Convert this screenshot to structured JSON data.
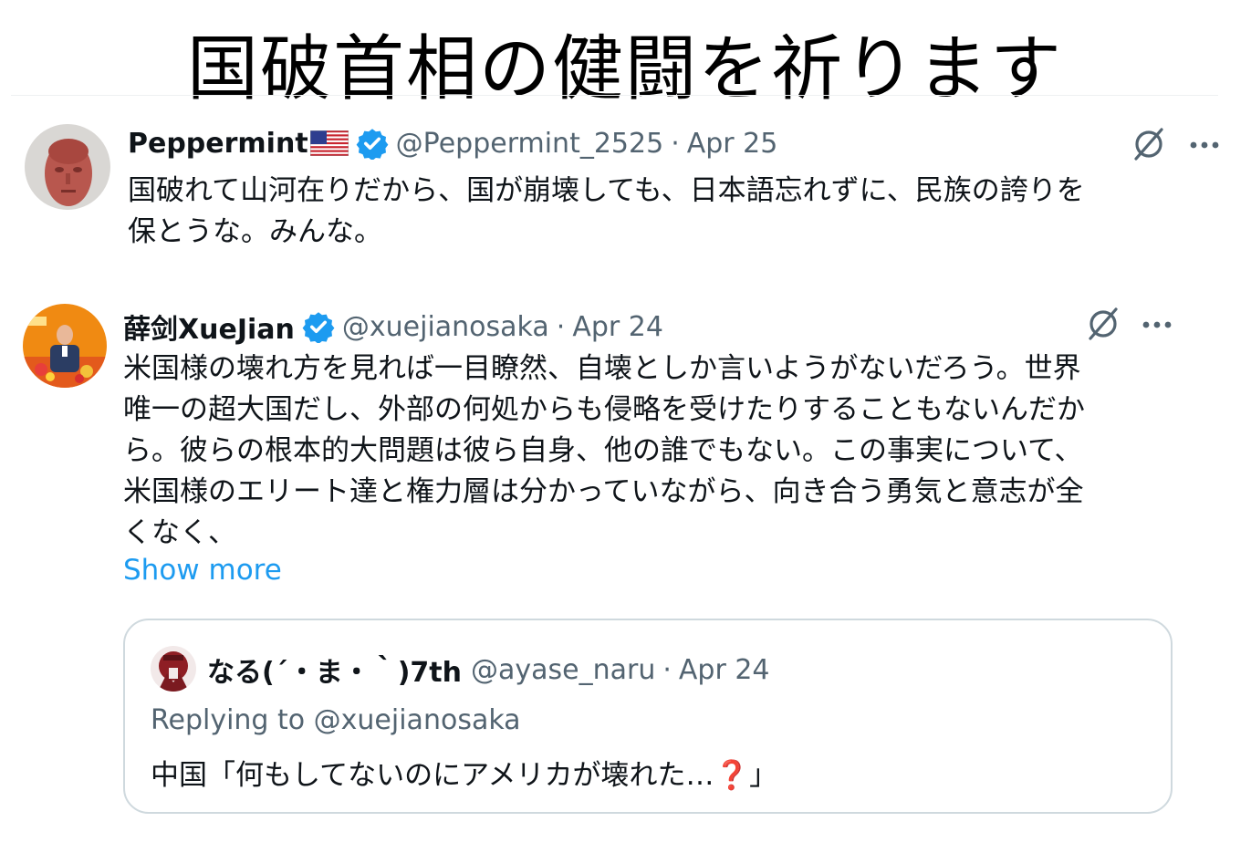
{
  "headline": "国破首相の健闘を祈ります",
  "tweets": [
    {
      "display_name": "Peppermint",
      "handle": "@Peppermint_2525",
      "separator": "·",
      "date": "Apr 25",
      "text": "国破れて山河在りだから、国が崩壊しても、日本語忘れずに、民族の誇りを\n保とうな。みんな。"
    },
    {
      "display_name": "薛剑XueJian",
      "handle": "@xuejianosaka",
      "separator": "·",
      "date": "Apr 24",
      "text": "米国様の壊れ方を見れば一目瞭然、自壊としか言いようがないだろう。世界\n唯一の超大国だし、外部の何処からも侵略を受けたりすることもないんだか\nら。彼らの根本的大問題は彼ら自身、他の誰でもない。この事実について、\n米国様のエリート達と権力層は分かっていながら、向き合う勇気と意志が全\nくなく、",
      "show_more": "Show more",
      "quote": {
        "display_name": "なる(´・ま・｀)7th",
        "handle": "@ayase_naru",
        "separator": "·",
        "date": "Apr 24",
        "replying_to": "Replying to @xuejianosaka",
        "text_before": "中国「何もしてないのにアメリカが壊れた…",
        "emoji": "❓",
        "text_after": "」"
      }
    }
  ],
  "colors": {
    "verified": "#1d9bf0",
    "link": "#1d9bf0",
    "secondary_text": "#536471",
    "card_border": "#cfd9de"
  },
  "icons": {
    "flag": "us-flag-icon",
    "verified": "verified-badge-icon",
    "grok": "grok-icon",
    "more": "more-icon"
  }
}
